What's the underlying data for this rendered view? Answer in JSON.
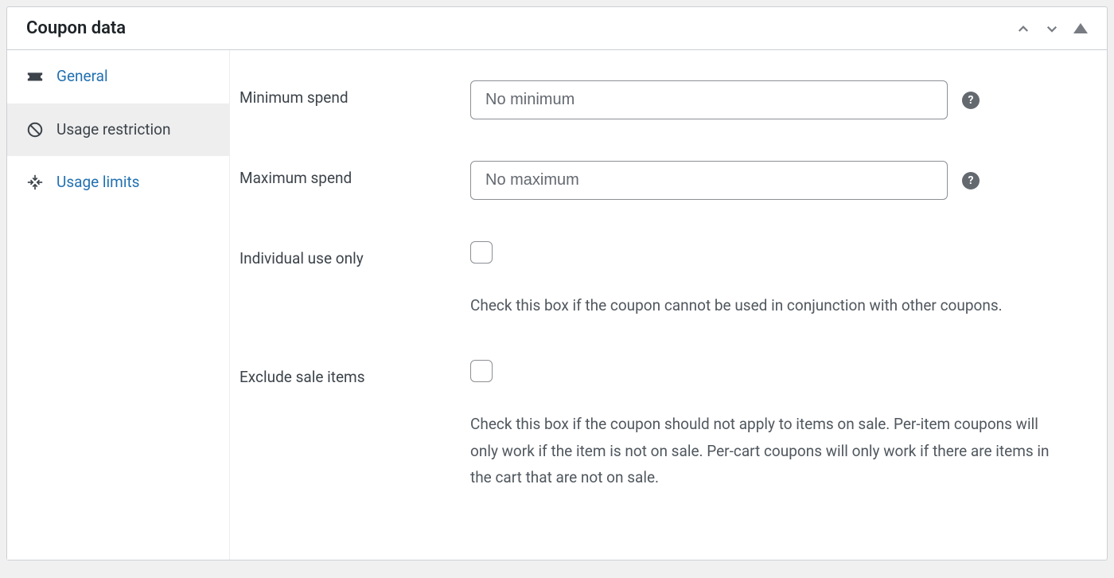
{
  "panel": {
    "title": "Coupon data"
  },
  "sidebar": {
    "items": [
      {
        "label": "General"
      },
      {
        "label": "Usage restriction"
      },
      {
        "label": "Usage limits"
      }
    ]
  },
  "fields": {
    "minimum_spend": {
      "label": "Minimum spend",
      "placeholder": "No minimum"
    },
    "maximum_spend": {
      "label": "Maximum spend",
      "placeholder": "No maximum"
    },
    "individual_use": {
      "label": "Individual use only",
      "description": "Check this box if the coupon cannot be used in conjunction with other coupons."
    },
    "exclude_sale": {
      "label": "Exclude sale items",
      "description": "Check this box if the coupon should not apply to items on sale. Per-item coupons will only work if the item is not on sale. Per-cart coupons will only work if there are items in the cart that are not on sale."
    }
  }
}
